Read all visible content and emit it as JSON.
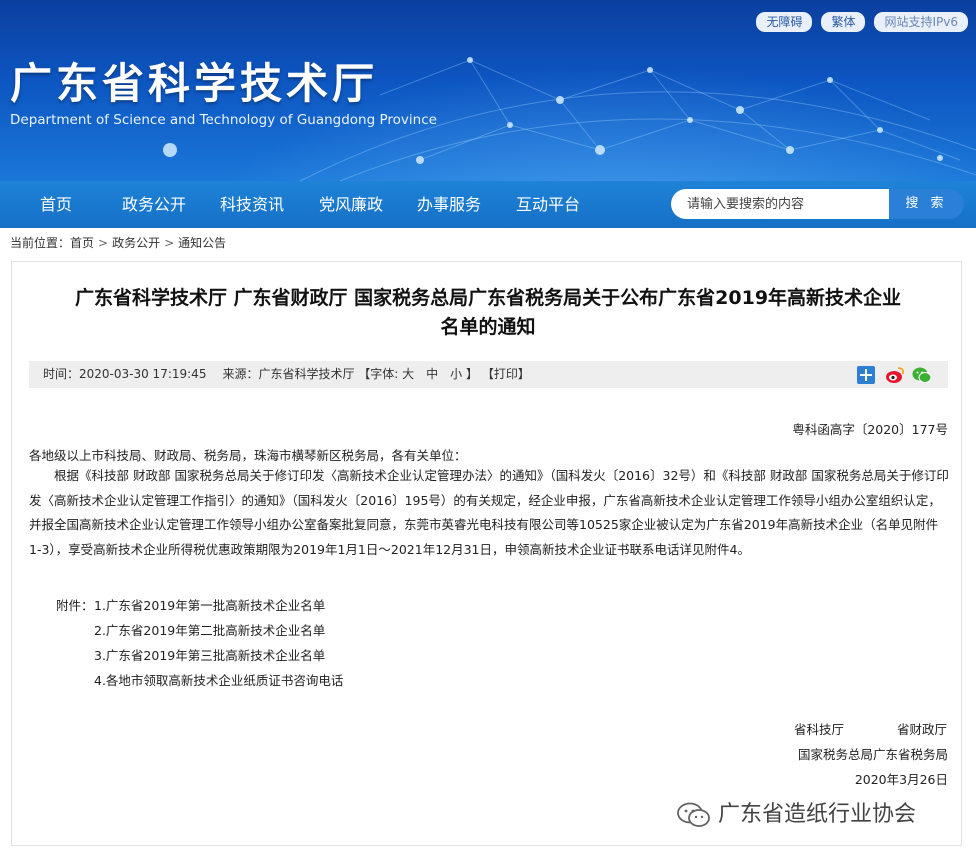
{
  "banner": {
    "title": "广东省科学技术厅",
    "subtitle": "Department of Science and Technology of Guangdong Province",
    "top_buttons": [
      "无障碍",
      "繁体",
      "网站支持IPv6"
    ]
  },
  "nav": {
    "items": [
      "首页",
      "政务公开",
      "科技资讯",
      "党风廉政",
      "办事服务",
      "互动平台"
    ],
    "search_placeholder": "请输入要搜索的内容",
    "search_button": "搜 索"
  },
  "breadcrumb": {
    "prefix": "当前位置：",
    "items": [
      "首页",
      "政务公开",
      "通知公告"
    ],
    "separator": ">"
  },
  "article": {
    "title_line1": "广东省科学技术厅 广东省财政厅 国家税务总局广东省税务局关于公布广东省2019年高新技术企业",
    "title_line2": "名单的通知",
    "meta": {
      "time": "时间：2020-03-30 17:19:45",
      "source": "来源：广东省科学技术厅",
      "font_size": "【字体: 大　中　小 】",
      "print": "【打印】"
    },
    "doc_number": "粤科函高字〔2020〕177号",
    "salutation": "各地级以上市科技局、财政局、税务局，珠海市横琴新区税务局，各有关单位：",
    "paragraph": "根据《科技部 财政部 国家税务总局关于修订印发〈高新技术企业认定管理办法〉的通知》（国科发火〔2016〕32号）和《科技部 财政部 国家税务总局关于修订印发〈高新技术企业认定管理工作指引〉的通知》（国科发火〔2016〕195号）的有关规定，经企业申报，广东省高新技术企业认定管理工作领导小组办公室组织认定，并报全国高新技术企业认定管理工作领导小组办公室备案批复同意，东莞市英睿光电科技有限公司等10525家企业被认定为广东省2019年高新技术企业（名单见附件1-3），享受高新技术企业所得税优惠政策期限为2019年1月1日～2021年12月31日，申领高新技术企业证书联系电话详见附件4。",
    "attachments_label": "附件：",
    "attachments": [
      "1.广东省2019年第一批高新技术企业名单",
      "2.广东省2019年第二批高新技术企业名单",
      "3.广东省2019年第三批高新技术企业名单",
      "4.各地市领取高新技术企业纸质证书咨询电话"
    ],
    "signatures": {
      "line1_left": "省科技厅",
      "line1_right": "省财政厅",
      "line2": "国家税务总局广东省税务局",
      "date": "2020年3月26日"
    }
  },
  "watermark": "广东省造纸行业协会",
  "share_icons": [
    "share-plus-icon",
    "weibo-icon",
    "wechat-icon"
  ],
  "colors": {
    "nav_blue": "#1a78cf",
    "banner_dark": "#0b3f9e",
    "search_button": "#2a7fd6",
    "meta_bg": "#eeeeee"
  }
}
